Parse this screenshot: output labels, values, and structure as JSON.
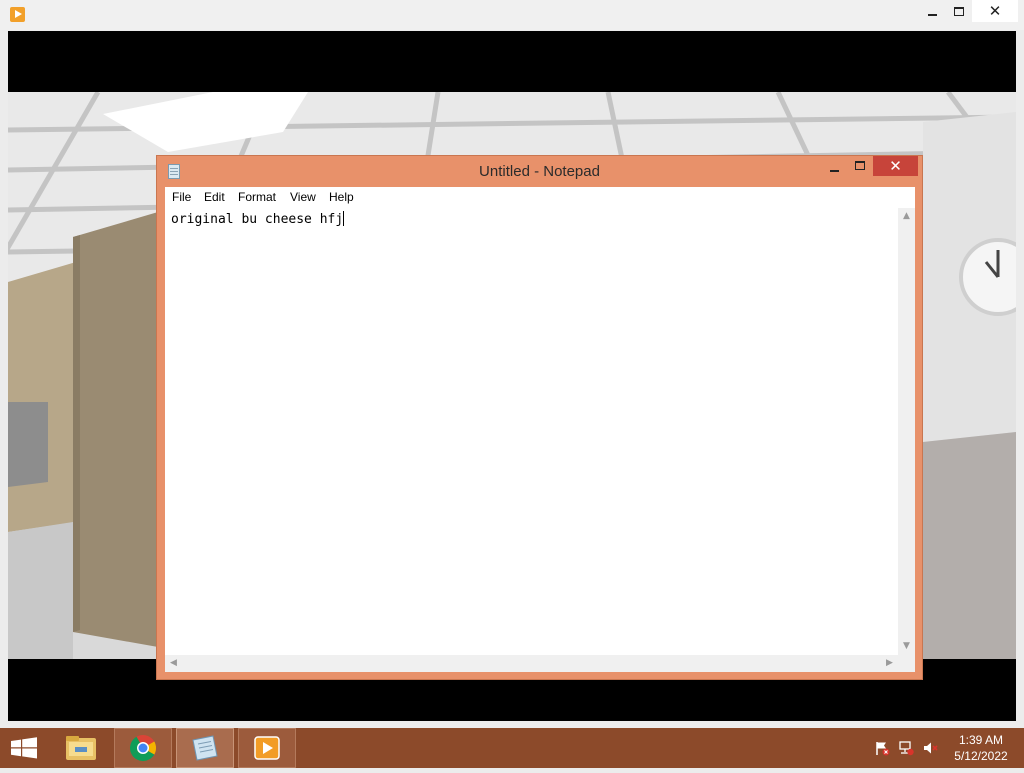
{
  "player_window": {
    "icon": "media-player-icon",
    "controls": [
      "minimize-icon",
      "maximize-icon",
      "close-icon"
    ]
  },
  "notepad": {
    "title": "Untitled - Notepad",
    "menu": [
      "File",
      "Edit",
      "Format",
      "View",
      "Help"
    ],
    "content": "original bu cheese hfj",
    "controls": [
      "minimize-icon",
      "maximize-icon",
      "close-icon"
    ]
  },
  "taskbar": {
    "apps": [
      "file-explorer-icon",
      "chrome-icon",
      "notepad-icon",
      "media-player-icon"
    ],
    "tray": [
      "action-center-flag-icon",
      "network-icon",
      "speaker-muted-icon"
    ],
    "time": "1:39 AM",
    "date": "5/12/2022"
  },
  "colors": {
    "accent": "#e8916a",
    "close": "#c7443a",
    "taskbar": "#8c4a2a"
  }
}
